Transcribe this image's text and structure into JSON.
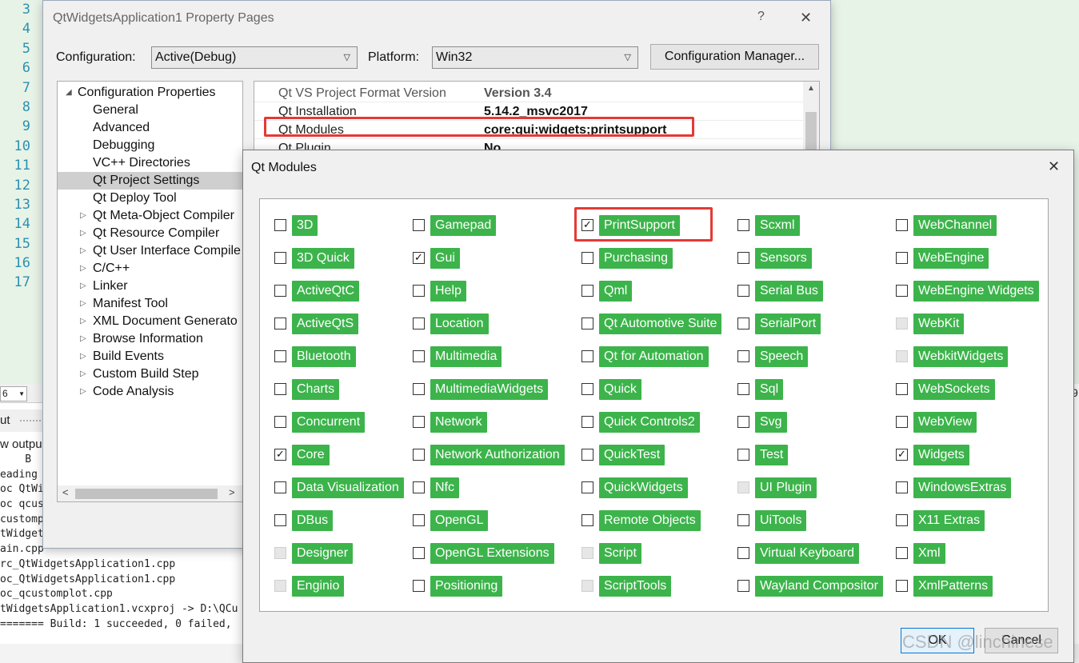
{
  "editor": {
    "line_numbers": [
      "3",
      "4",
      "5",
      "6",
      "7",
      "8",
      "9",
      "10",
      "11",
      "12",
      "13",
      "14",
      "15",
      "16",
      "17"
    ],
    "zoom_value": "6",
    "output_title": "ut",
    "show_output_label": "w outpu",
    "output_lines": [
      "    B",
      "eading (",
      "oc QtWi",
      "oc qcus",
      "customp",
      "tWidget",
      "ain.cpp",
      "rc_QtWidgetsApplication1.cpp",
      "oc_QtWidgetsApplication1.cpp",
      "oc_qcustomplot.cpp",
      "tWidgetsApplication1.vcxproj -> D:\\QCu",
      "======= Build: 1 succeeded, 0 failed, "
    ],
    "right_edge_number": "9"
  },
  "property_pages": {
    "title": "QtWidgetsApplication1 Property Pages",
    "help_glyph": "?",
    "close_glyph": "✕",
    "configuration_label": "Configuration:",
    "configuration_value": "Active(Debug)",
    "platform_label": "Platform:",
    "platform_value": "Win32",
    "configuration_manager_label": "Configuration Manager...",
    "tree": [
      {
        "label": "Configuration Properties",
        "arrow": "◢"
      },
      {
        "label": "General"
      },
      {
        "label": "Advanced"
      },
      {
        "label": "Debugging"
      },
      {
        "label": "VC++ Directories"
      },
      {
        "label": "Qt Project Settings",
        "selected": true
      },
      {
        "label": "Qt Deploy Tool"
      },
      {
        "label": "Qt Meta-Object Compiler",
        "arrow": "▷"
      },
      {
        "label": "Qt Resource Compiler",
        "arrow": "▷"
      },
      {
        "label": "Qt User Interface Compile",
        "arrow": "▷"
      },
      {
        "label": "C/C++",
        "arrow": "▷"
      },
      {
        "label": "Linker",
        "arrow": "▷"
      },
      {
        "label": "Manifest Tool",
        "arrow": "▷"
      },
      {
        "label": "XML Document Generato",
        "arrow": "▷"
      },
      {
        "label": "Browse Information",
        "arrow": "▷"
      },
      {
        "label": "Build Events",
        "arrow": "▷"
      },
      {
        "label": "Custom Build Step",
        "arrow": "▷"
      },
      {
        "label": "Code Analysis",
        "arrow": "▷"
      }
    ],
    "grid": [
      {
        "name": "Qt VS Project Format Version",
        "value": "Version 3.4"
      },
      {
        "name": "Qt Installation",
        "value": "5.14.2_msvc2017"
      },
      {
        "name": "Qt Modules",
        "value": "core;gui;widgets;printsupport"
      },
      {
        "name": "Qt Plugin",
        "value": "No"
      }
    ]
  },
  "qt_modules": {
    "title": "Qt Modules",
    "close_glyph": "✕",
    "columns": [
      [
        {
          "label": "3D",
          "state": "unchecked"
        },
        {
          "label": "3D Quick",
          "state": "unchecked"
        },
        {
          "label": "ActiveQtC",
          "state": "unchecked"
        },
        {
          "label": "ActiveQtS",
          "state": "unchecked"
        },
        {
          "label": "Bluetooth",
          "state": "unchecked"
        },
        {
          "label": "Charts",
          "state": "unchecked"
        },
        {
          "label": "Concurrent",
          "state": "unchecked"
        },
        {
          "label": "Core",
          "state": "checked"
        },
        {
          "label": "Data Visualization",
          "state": "unchecked"
        },
        {
          "label": "DBus",
          "state": "unchecked"
        },
        {
          "label": "Designer",
          "state": "disabled"
        },
        {
          "label": "Enginio",
          "state": "disabled"
        }
      ],
      [
        {
          "label": "Gamepad",
          "state": "unchecked"
        },
        {
          "label": "Gui",
          "state": "checked"
        },
        {
          "label": "Help",
          "state": "unchecked"
        },
        {
          "label": "Location",
          "state": "unchecked"
        },
        {
          "label": "Multimedia",
          "state": "unchecked"
        },
        {
          "label": "MultimediaWidgets",
          "state": "unchecked"
        },
        {
          "label": "Network",
          "state": "unchecked"
        },
        {
          "label": "Network Authorization",
          "state": "unchecked"
        },
        {
          "label": "Nfc",
          "state": "unchecked"
        },
        {
          "label": "OpenGL",
          "state": "unchecked"
        },
        {
          "label": "OpenGL Extensions",
          "state": "unchecked"
        },
        {
          "label": "Positioning",
          "state": "unchecked"
        }
      ],
      [
        {
          "label": "PrintSupport",
          "state": "checked"
        },
        {
          "label": "Purchasing",
          "state": "unchecked"
        },
        {
          "label": "Qml",
          "state": "unchecked"
        },
        {
          "label": "Qt Automotive Suite",
          "state": "unchecked"
        },
        {
          "label": "Qt for Automation",
          "state": "unchecked"
        },
        {
          "label": "Quick",
          "state": "unchecked"
        },
        {
          "label": "Quick Controls2",
          "state": "unchecked"
        },
        {
          "label": "QuickTest",
          "state": "unchecked"
        },
        {
          "label": "QuickWidgets",
          "state": "unchecked"
        },
        {
          "label": "Remote Objects",
          "state": "unchecked"
        },
        {
          "label": "Script",
          "state": "disabled"
        },
        {
          "label": "ScriptTools",
          "state": "disabled"
        }
      ],
      [
        {
          "label": "Scxml",
          "state": "unchecked"
        },
        {
          "label": "Sensors",
          "state": "unchecked"
        },
        {
          "label": "Serial Bus",
          "state": "unchecked"
        },
        {
          "label": "SerialPort",
          "state": "unchecked"
        },
        {
          "label": "Speech",
          "state": "unchecked"
        },
        {
          "label": "Sql",
          "state": "unchecked"
        },
        {
          "label": "Svg",
          "state": "unchecked"
        },
        {
          "label": "Test",
          "state": "unchecked"
        },
        {
          "label": "UI Plugin",
          "state": "disabled"
        },
        {
          "label": "UiTools",
          "state": "unchecked"
        },
        {
          "label": "Virtual Keyboard",
          "state": "unchecked"
        },
        {
          "label": "Wayland Compositor",
          "state": "unchecked"
        }
      ],
      [
        {
          "label": "WebChannel",
          "state": "unchecked"
        },
        {
          "label": "WebEngine",
          "state": "unchecked"
        },
        {
          "label": "WebEngine Widgets",
          "state": "unchecked"
        },
        {
          "label": "WebKit",
          "state": "disabled"
        },
        {
          "label": "WebkitWidgets",
          "state": "disabled"
        },
        {
          "label": "WebSockets",
          "state": "unchecked"
        },
        {
          "label": "WebView",
          "state": "unchecked"
        },
        {
          "label": "Widgets",
          "state": "checked"
        },
        {
          "label": "WindowsExtras",
          "state": "unchecked"
        },
        {
          "label": "X11 Extras",
          "state": "unchecked"
        },
        {
          "label": "Xml",
          "state": "unchecked"
        },
        {
          "label": "XmlPatterns",
          "state": "unchecked"
        }
      ]
    ],
    "ok_label": "OK",
    "cancel_label": "Cancel",
    "tag_color": "#3cb44b",
    "highlight_color": "#e53935"
  },
  "watermark": "CSDN @linchinese"
}
